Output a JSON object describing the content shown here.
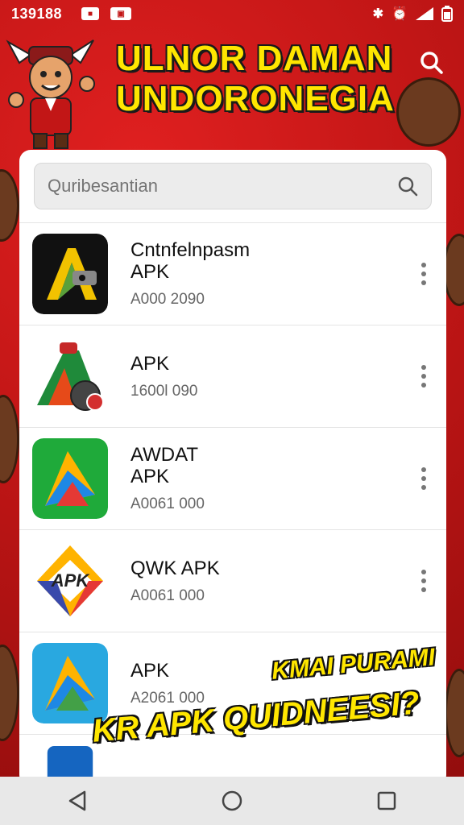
{
  "status_bar": {
    "time": "139188"
  },
  "header": {
    "title_line1": "ULNOR DAMAN",
    "title_line2": "UNDORONEGIA"
  },
  "search": {
    "placeholder": "Quribesantian"
  },
  "apps": [
    {
      "title": "Cntnfelnpasm\nAPK",
      "meta": "A000 2090"
    },
    {
      "title": "APK",
      "meta": "1600l 090"
    },
    {
      "title": "AWDAT\nAPK",
      "meta": "A0061 000"
    },
    {
      "title": "QWK APK",
      "meta": "A0061 000",
      "icon_text": "APK"
    },
    {
      "title": "APK",
      "meta": "A2061 000"
    }
  ],
  "promo": {
    "line1": "KMAI PURAMI",
    "line2": "KR APK QUIDNEESI?"
  },
  "colors": {
    "background_red": "#c21616",
    "title_yellow": "#ffe600",
    "panel_white": "#ffffff"
  },
  "icons": [
    "search-icon",
    "more-vert-icon",
    "back-icon",
    "home-icon",
    "recents-icon"
  ]
}
